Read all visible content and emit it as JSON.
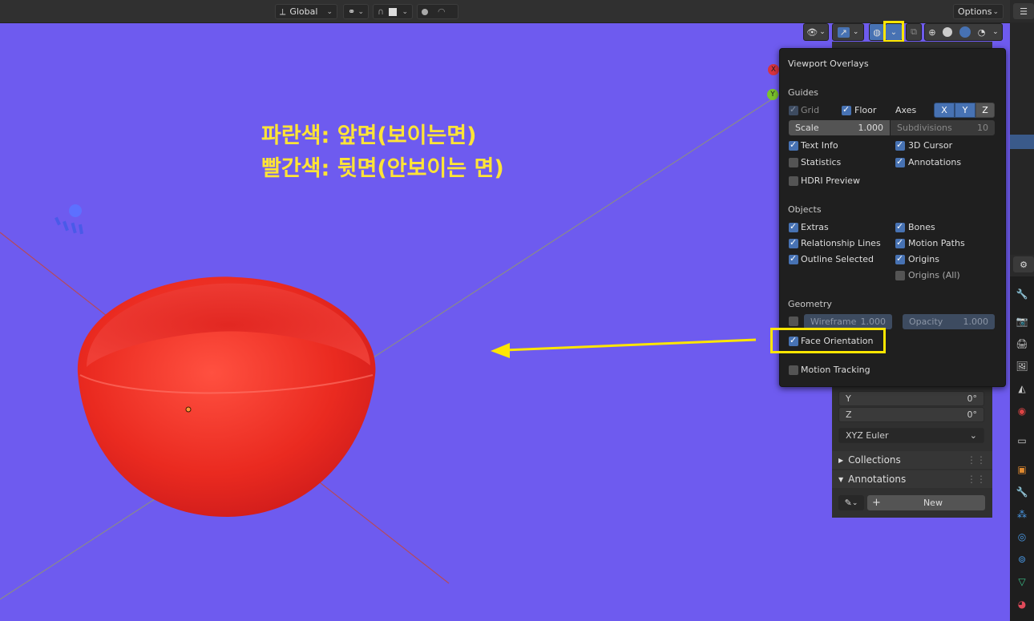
{
  "header": {
    "transform_orientation": "Global",
    "options_label": "Options"
  },
  "annotation": {
    "line1": "파란색: 앞면(보이는면)",
    "line2": "빨간색: 뒷면(안보이는 면)"
  },
  "viewport": {
    "axis_x": "X",
    "axis_y": "Y"
  },
  "overlays_popup": {
    "title": "Viewport Overlays",
    "guides_heading": "Guides",
    "grid": "Grid",
    "floor": "Floor",
    "axes": "Axes",
    "axis_x": "X",
    "axis_y": "Y",
    "axis_z": "Z",
    "scale_label": "Scale",
    "scale_value": "1.000",
    "subdivisions_label": "Subdivisions",
    "subdivisions_value": "10",
    "text_info": "Text Info",
    "cursor_3d": "3D Cursor",
    "statistics": "Statistics",
    "annotations": "Annotations",
    "hdri_preview": "HDRI Preview",
    "objects_heading": "Objects",
    "extras": "Extras",
    "bones": "Bones",
    "relationship_lines": "Relationship Lines",
    "motion_paths": "Motion Paths",
    "outline_selected": "Outline Selected",
    "origins": "Origins",
    "origins_all": "Origins (All)",
    "geometry_heading": "Geometry",
    "wireframe_label": "Wireframe",
    "wireframe_value": "1.000",
    "opacity_label": "Opacity",
    "opacity_value": "1.000",
    "face_orientation": "Face Orientation",
    "motion_tracking": "Motion Tracking"
  },
  "npanel": {
    "y_label": "Y",
    "y_value": "0°",
    "z_label": "Z",
    "z_value": "0°",
    "rotation_mode": "XYZ Euler",
    "collections": "Collections",
    "annotations": "Annotations",
    "new_button": "New"
  },
  "colors": {
    "viewport_front_face": "#6e5bef",
    "back_face": "#e8221f",
    "highlight": "#ffe600",
    "checkbox_on": "#4772b3"
  }
}
